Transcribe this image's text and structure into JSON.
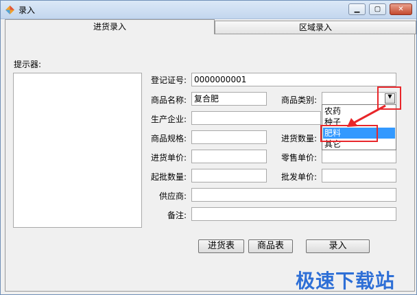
{
  "window": {
    "title": "录入"
  },
  "tabs": [
    {
      "label": "进货录入",
      "active": true
    },
    {
      "label": "区域录入",
      "active": false
    }
  ],
  "hint": {
    "label": "提示器:"
  },
  "form": {
    "reg_no_label": "登记证号:",
    "reg_no_value": "0000000001",
    "product_name_label": "商品名称:",
    "product_name_value": "复合肥",
    "category_label": "商品类别:",
    "category_value": "",
    "manufacturer_label": "生产企业:",
    "spec_label": "商品规格:",
    "purchase_qty_label": "进货数量:",
    "purchase_price_label": "进货单价:",
    "retail_price_label": "零售单价:",
    "min_batch_label": "起批数量:",
    "wholesale_price_label": "批发单价:",
    "supplier_label": "供应商:",
    "remark_label": "备注:"
  },
  "category_options": [
    {
      "label": "农药",
      "selected": false
    },
    {
      "label": "种子",
      "selected": false
    },
    {
      "label": "肥料",
      "selected": true
    },
    {
      "label": "其它",
      "selected": false
    }
  ],
  "buttons": {
    "purchase_table": "进货表",
    "product_table": "商品表",
    "submit": "录入"
  },
  "watermark": "极速下载站",
  "colors": {
    "highlight": "#e8262a",
    "selection": "#3399ff",
    "watermark": "#2e6fd6"
  },
  "icons": {
    "minimize": "minimize-icon",
    "maximize": "maximize-icon",
    "close": "close-icon",
    "dropdown": "chevron-down-icon"
  }
}
